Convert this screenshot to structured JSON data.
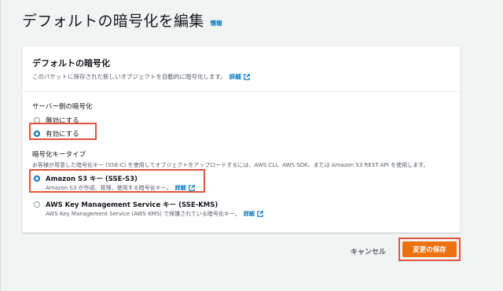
{
  "header": {
    "title": "デフォルトの暗号化を編集",
    "info": "情報"
  },
  "panel": {
    "title": "デフォルトの暗号化",
    "description": "このバケットに保存された新しいオブジェクトを自動的に暗号化します。",
    "details_link": "詳細"
  },
  "server_side": {
    "label": "サーバー側の暗号化",
    "options": [
      {
        "label": "無効にする",
        "selected": false
      },
      {
        "label": "有効にする",
        "selected": true
      }
    ]
  },
  "key_type": {
    "label": "暗号化キータイプ",
    "description": "お客様が用意した暗号化キー (SSE-C) を使用してオブジェクトをアップロードするには、AWS CLI、AWS SDK、または Amazon S3 REST API を使用します。",
    "options": [
      {
        "label": "Amazon S3 キー (SSE-S3)",
        "description": "Amazon S3 が作成、管理、使用する暗号化キー。",
        "link": "詳細",
        "selected": true
      },
      {
        "label": "AWS Key Management Service キー (SSE-KMS)",
        "description": "AWS Key Management Service (AWS KMS) で保護されている暗号化キー。",
        "link": "詳細",
        "selected": false
      }
    ]
  },
  "footer": {
    "cancel": "キャンセル",
    "save": "変更の保存"
  },
  "colors": {
    "primary": "#ec7211",
    "link": "#0073bb",
    "highlight": "#e0533e"
  }
}
